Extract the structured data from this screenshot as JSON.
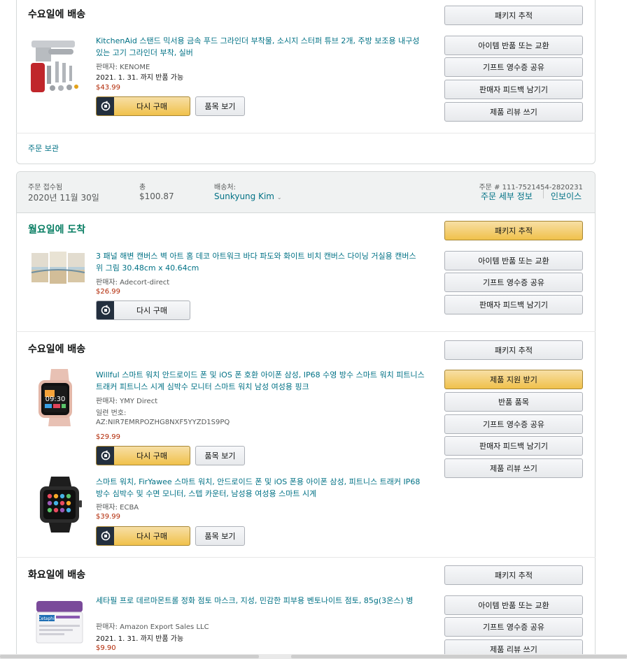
{
  "top_shipment": {
    "status": "수요일에 배송",
    "product": {
      "title": "KitchenAid 스탠드 믹서용 금속 푸드 그라인더 부착물, 소시지 스터퍼 튜브 2개, 주방 보조용 내구성 있는 고기 그라인더 부착, 실버",
      "seller": "판매자: KENOME",
      "return_window": "2021. 1. 31. 까지 반품 가능",
      "price": "$43.99"
    },
    "buy_again": "다시 구매",
    "view_item": "품목 보기",
    "actions": [
      "패키지 추적",
      "아이템 반품 또는 교환",
      "기프트 영수증 공유",
      "판매자 피드백 남기기",
      "제품 리뷰 쓰기"
    ],
    "archive": "주문 보관"
  },
  "order_header": {
    "placed_label": "주문 접수됨",
    "placed_value": "2020년 11월 30일",
    "total_label": "총",
    "total_value": "$100.87",
    "ship_to_label": "배송처:",
    "ship_to_value": "Sunkyung Kim",
    "order_number": "주문 # 111-7521454-2820231",
    "details_link": "주문 세부 정보",
    "invoice_link": "인보이스"
  },
  "shipment_monday": {
    "status": "월요일에 도착",
    "product": {
      "title": "3 패널 해변 캔버스 벽 아트 홈 데코 아트워크 바다 파도와 화이트 비치 캔버스 다이닝 거실용 캔버스 위 그림 30.48cm x 40.64cm",
      "seller": "판매자: Adecort-direct",
      "price": "$26.99"
    },
    "buy_again": "다시 구매",
    "actions": [
      "패키지 추적",
      "아이템 반품 또는 교환",
      "기프트 영수증 공유",
      "판매자 피드백 남기기"
    ]
  },
  "shipment_wednesday": {
    "status": "수요일에 배송",
    "products": [
      {
        "title": "Willful 스마트 워치 안드로이드 폰 및 iOS 폰 호환 아이폰 삼성, IP68 수영 방수 스마트 워치 피트니스 트래커 피트니스 시계 심박수 모니터 스마트 워치 남성 여성용 핑크",
        "seller": "판매자: YMY Direct",
        "serial_label": "일련 번호:",
        "serial_value": "AZ:NIR7EMRPOZHG8NXF5YYZD1S9PQ",
        "price": "$29.99",
        "watch_time": "09:30"
      },
      {
        "title": "스마트 워치, FirYawee 스마트 워치, 안드로이드 폰 및 iOS 폰용 아이폰 삼성, 피트니스 트래커 IP68 방수 심박수 및 수면 모니터, 스텝 카운터, 남성용 여성용 스마트 시계",
        "seller": "판매자: ECBA",
        "price": "$39.99"
      }
    ],
    "buy_again": "다시 구매",
    "view_item": "품목 보기",
    "actions": [
      "패키지 추적",
      "제품 지원 받기",
      "반품 품목",
      "기프트 영수증 공유",
      "판매자 피드백 남기기",
      "제품 리뷰 쓰기"
    ]
  },
  "shipment_tuesday": {
    "status": "화요일에 배송",
    "product": {
      "title": "세타필 프로 데르마몬트롤 정화 점토 마스크, 지성, 민감한 피부용 벤토나이트 점토, 85g(3온스) 병",
      "seller": "판매자: Amazon Export Sales LLC",
      "return_window": "2021. 1. 31. 까지 반품 가능",
      "price": "$9.90",
      "brand_mark": "Cetaphil"
    },
    "actions": [
      "패키지 추적",
      "아이템 반품 또는 교환",
      "기프트 영수증 공유",
      "제품 리뷰 쓰기"
    ]
  },
  "colors": {
    "link": "#007185",
    "price": "#b12704",
    "arrived_green": "#067d62",
    "yellow_button": "#f0c14b"
  }
}
